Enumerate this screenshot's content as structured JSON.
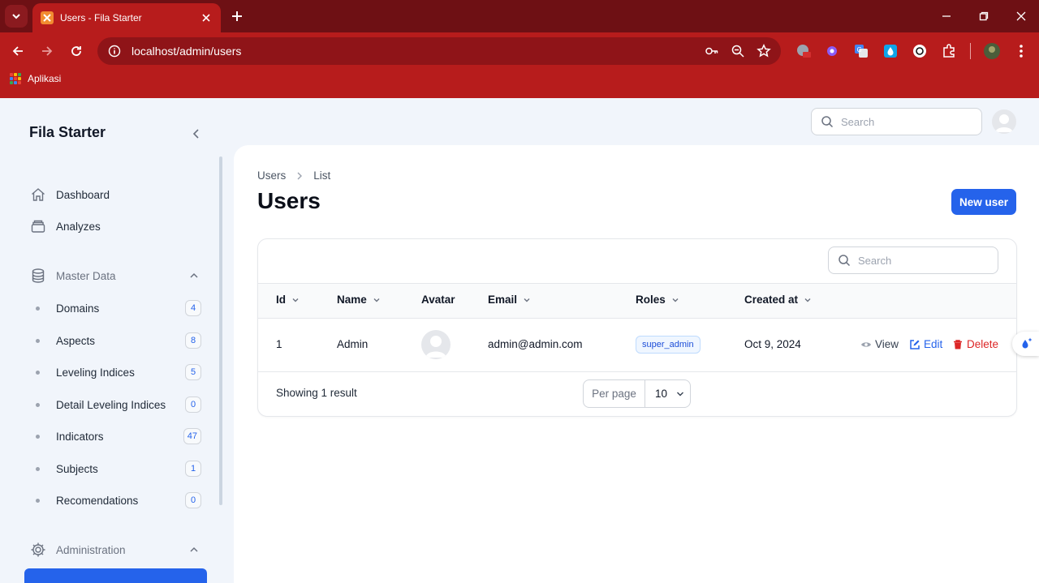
{
  "browser": {
    "tab_title": "Users - Fila Starter",
    "url": "localhost/admin/users",
    "bookmarks_label": "Aplikasi",
    "colors": {
      "tabstrip": "#6e1014",
      "toolbar": "#b71c1c"
    }
  },
  "sidebar": {
    "brand": "Fila Starter",
    "items": [
      {
        "label": "Dashboard",
        "icon": "home-icon"
      },
      {
        "label": "Analyzes",
        "icon": "archive-icon"
      }
    ],
    "master_data": {
      "label": "Master Data",
      "icon": "database-icon",
      "items": [
        {
          "label": "Domains",
          "count": "4"
        },
        {
          "label": "Aspects",
          "count": "8"
        },
        {
          "label": "Leveling Indices",
          "count": "5"
        },
        {
          "label": "Detail Leveling Indices",
          "count": "0"
        },
        {
          "label": "Indicators",
          "count": "47"
        },
        {
          "label": "Subjects",
          "count": "1"
        },
        {
          "label": "Recomendations",
          "count": "0"
        }
      ]
    },
    "administration": {
      "label": "Administration",
      "icon": "gear-icon"
    }
  },
  "topbar": {
    "search_placeholder": "Search"
  },
  "page": {
    "breadcrumb": [
      "Users",
      "List"
    ],
    "title": "Users",
    "new_button": "New user",
    "accent_color": "#2563eb"
  },
  "table": {
    "search_placeholder": "Search",
    "columns": [
      "Id",
      "Name",
      "Avatar",
      "Email",
      "Roles",
      "Created at"
    ],
    "rows": [
      {
        "id": "1",
        "name": "Admin",
        "email": "admin@admin.com",
        "role": "super_admin",
        "created_at": "Oct 9, 2024"
      }
    ],
    "actions": {
      "view": "View",
      "edit": "Edit",
      "delete": "Delete"
    },
    "footer": {
      "showing": "Showing 1 result",
      "per_page_label": "Per page",
      "per_page_value": "10"
    }
  }
}
